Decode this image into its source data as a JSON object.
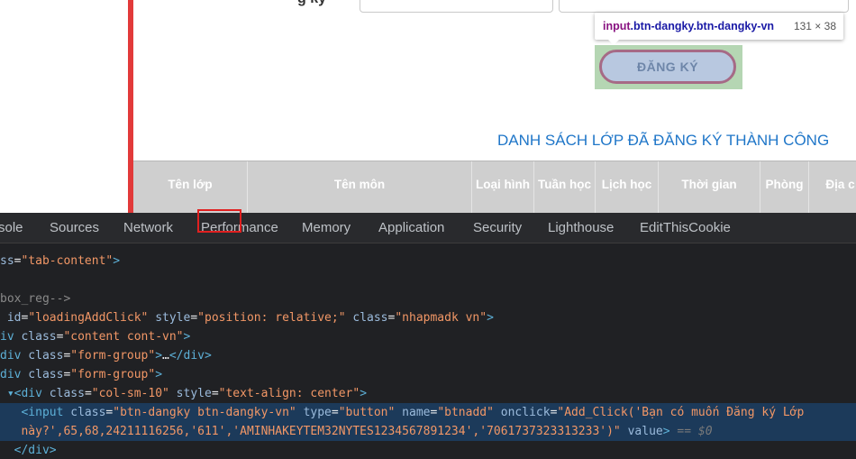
{
  "tooltip": {
    "tag": "input",
    "classes": ".btn-dangky.btn-dangky-vn",
    "size": "131 × 38"
  },
  "register_button": {
    "label": "ĐĂNG KÝ"
  },
  "list_title": "DANH SÁCH LỚP ĐÃ ĐĂNG KÝ THÀNH CÔNG",
  "field_label_partial": "g ký",
  "table_headers": [
    "Tên lớp",
    "Tên môn",
    "Loại hình",
    "Tuần học",
    "Lịch học",
    "Thời gian",
    "Phòng",
    "Địa c"
  ],
  "devtools": {
    "tabs": [
      "sole",
      "Sources",
      "Network",
      "Performance",
      "Memory",
      "Application",
      "Security",
      "Lighthouse",
      "EditThisCookie"
    ],
    "code": {
      "l1_attr": "ss",
      "l1_val": "\"tab-content\"",
      "l1_close": ">",
      "l2_comment": "box_reg-->",
      "l3_attr1": " id",
      "l3_val1": "\"loadingAddClick\"",
      "l3_attr2": " style",
      "l3_val2": "\"position: relative;\"",
      "l3_attr3": " class",
      "l3_val3": "\"nhapmadk vn\"",
      "l4_tag": "iv",
      "l4_attr": " class",
      "l4_val": "\"content cont-vn\"",
      "l5_tag": "div",
      "l5_attr": " class",
      "l5_val": "\"form-group\"",
      "l5_rest": "…",
      "l5_close": "</div>",
      "l6_tag": "div",
      "l6_attr": " class",
      "l6_val": "\"form-group\"",
      "l7_tag": "<div",
      "l7_attr1": " class",
      "l7_val1": "\"col-sm-10\"",
      "l7_attr2": " style",
      "l7_val2": "\"text-align: center\"",
      "l8_tag": "<input",
      "l8_attr1": " class",
      "l8_val1": "\"btn-dangky btn-dangky-vn\"",
      "l8_attr2": " type",
      "l8_val2": "\"button\"",
      "l8_attr3": " name",
      "l8_val3": "\"btnadd\"",
      "l8_attr4": " onclick",
      "l8_val4a": "\"Add_Click('Bạn có muốn Đăng ký Lớp",
      "l9_val_a": "này?',65,68,24211116256",
      "l9_val_b": ",'611'",
      "l9_val_c": ",'AMINHAKEYTEM32NYTES1234567891234','7061737323313233')\"",
      "l9_attr": " value",
      "l9_eq": "== $0",
      "l10_close": "</div>"
    }
  }
}
